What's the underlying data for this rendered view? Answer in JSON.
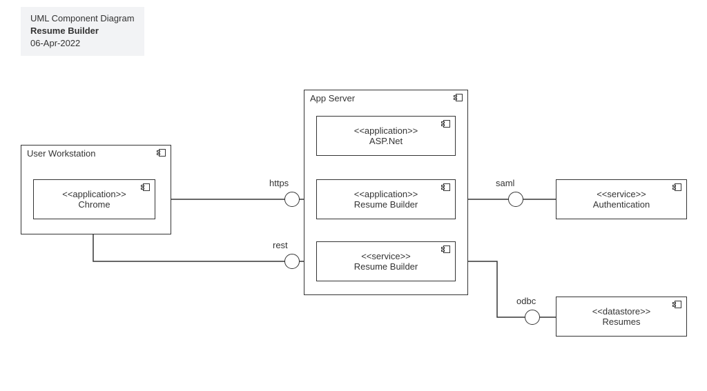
{
  "header": {
    "title": "UML Component Diagram",
    "name": "Resume Builder",
    "date": "06-Apr-2022"
  },
  "containers": {
    "user_workstation": {
      "label": "User Workstation"
    },
    "app_server": {
      "label": "App Server"
    }
  },
  "components": {
    "chrome": {
      "stereotype": "<<application>>",
      "name": "Chrome"
    },
    "aspnet": {
      "stereotype": "<<application>>",
      "name": "ASP.Net"
    },
    "resume_builder_app": {
      "stereotype": "<<application>>",
      "name": "Resume Builder"
    },
    "resume_builder_svc": {
      "stereotype": "<<service>>",
      "name": "Resume Builder"
    },
    "authentication": {
      "stereotype": "<<service>>",
      "name": "Authentication"
    },
    "resumes": {
      "stereotype": "<<datastore>>",
      "name": "Resumes"
    }
  },
  "connectors": {
    "https": {
      "label": "https"
    },
    "rest": {
      "label": "rest"
    },
    "saml": {
      "label": "saml"
    },
    "odbc": {
      "label": "odbc"
    }
  }
}
